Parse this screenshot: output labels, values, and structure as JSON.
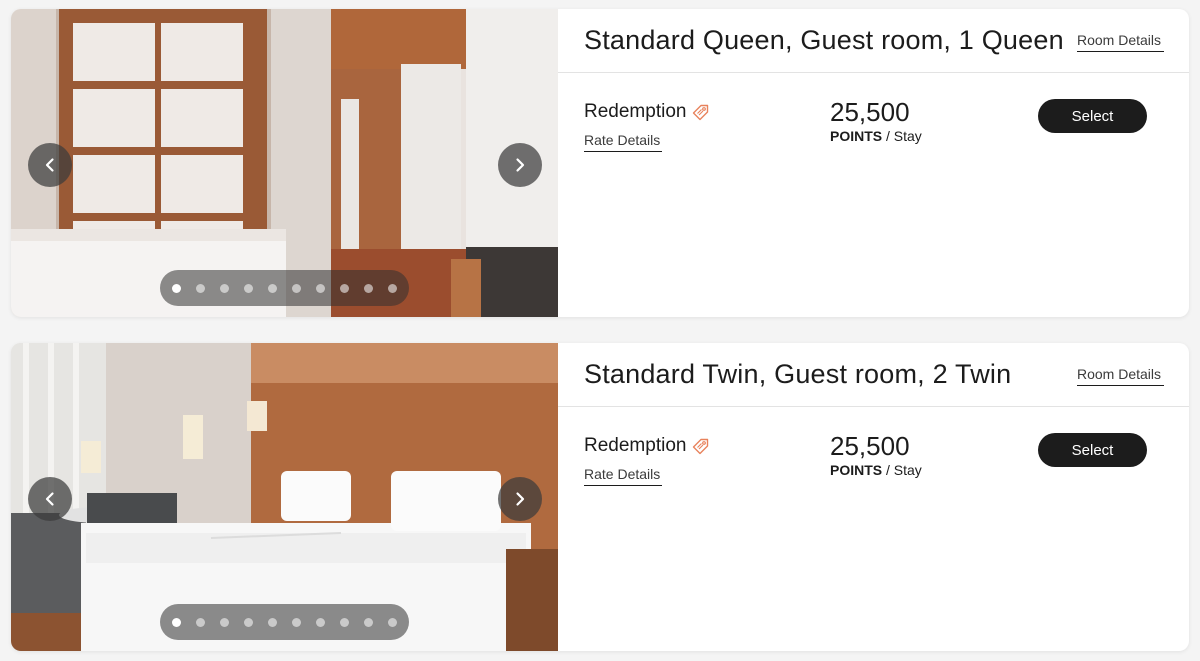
{
  "rooms": [
    {
      "title": "Standard Queen, Guest room, 1 Queen",
      "room_details_label": "Room Details",
      "rate_name": "Redemption",
      "rate_icon": "tag-icon",
      "rate_details_label": "Rate Details",
      "price": "25,500",
      "price_unit": "POINTS",
      "price_suffix": " / Stay",
      "select_label": "Select",
      "gallery": {
        "image_count": 10,
        "active_index": 0
      }
    },
    {
      "title": "Standard Twin, Guest room, 2 Twin",
      "room_details_label": "Room Details",
      "rate_name": "Redemption",
      "rate_icon": "tag-icon",
      "rate_details_label": "Rate Details",
      "price": "25,500",
      "price_unit": "POINTS",
      "price_suffix": " / Stay",
      "select_label": "Select",
      "gallery": {
        "image_count": 10,
        "active_index": 0
      }
    }
  ],
  "colors": {
    "accent_tag": "#e8825c",
    "button_bg": "#1c1c1c",
    "text": "#1c1c1c"
  }
}
